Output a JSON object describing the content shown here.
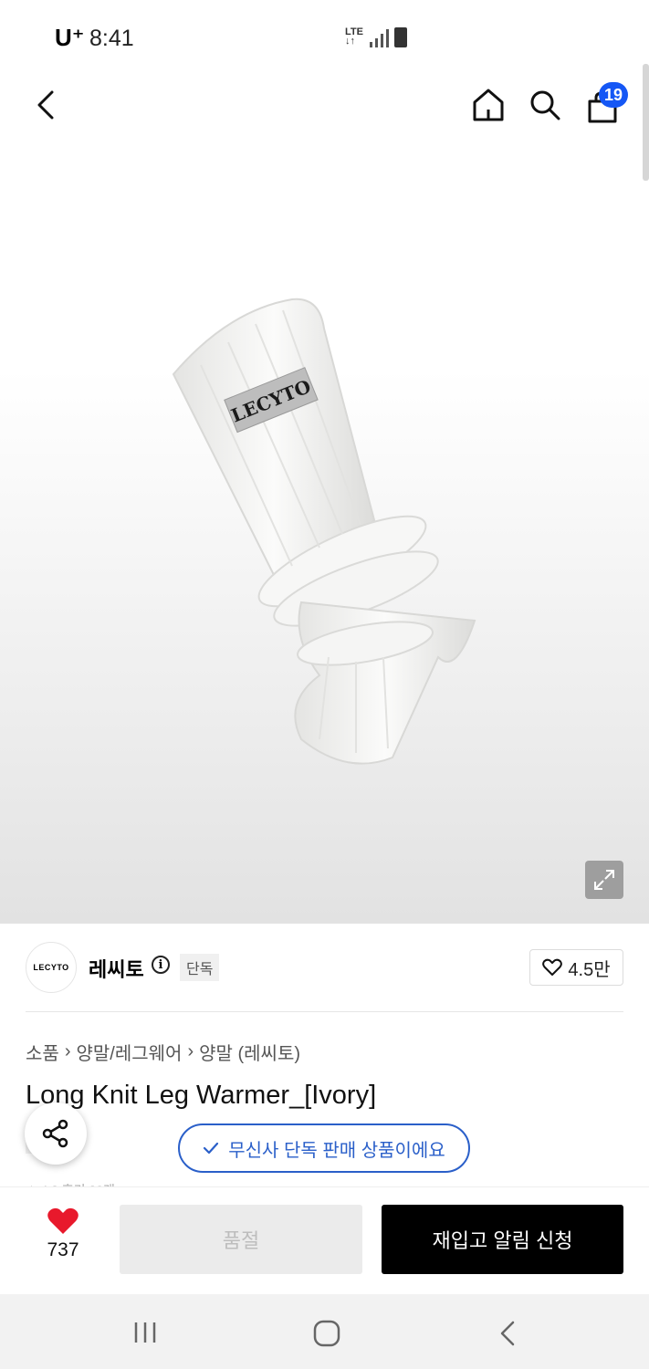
{
  "status_bar": {
    "carrier": "U⁺",
    "time": "8:41",
    "network": "LTE"
  },
  "header": {
    "cart_count": "19"
  },
  "product_image": {
    "brand_label": "LECYTO",
    "colors": {
      "knit": "#f3f3f1",
      "patch": "#b9b9b9"
    }
  },
  "brand": {
    "logo_text": "LECYTO",
    "name": "레씨토",
    "exclusive_tag": "단독",
    "likes": "4.5만"
  },
  "breadcrumb": [
    "소품",
    "양말/레그웨어",
    "양말 (레씨토)"
  ],
  "product": {
    "title": "Long Knit Leg Warmer_[Ivory]",
    "tag": "단독",
    "peek_text": "★ 4.8 후기 30개"
  },
  "toast": {
    "text": "무신사 단독 판매 상품이에요"
  },
  "bottom_bar": {
    "heart_count": "737",
    "sold_out_label": "품절",
    "restock_label": "재입고 알림 신청",
    "colors": {
      "heart": "#e8192c",
      "restock_bg": "#000000"
    }
  },
  "accent_color": "#2a5fc9",
  "badge_color": "#1557f5"
}
